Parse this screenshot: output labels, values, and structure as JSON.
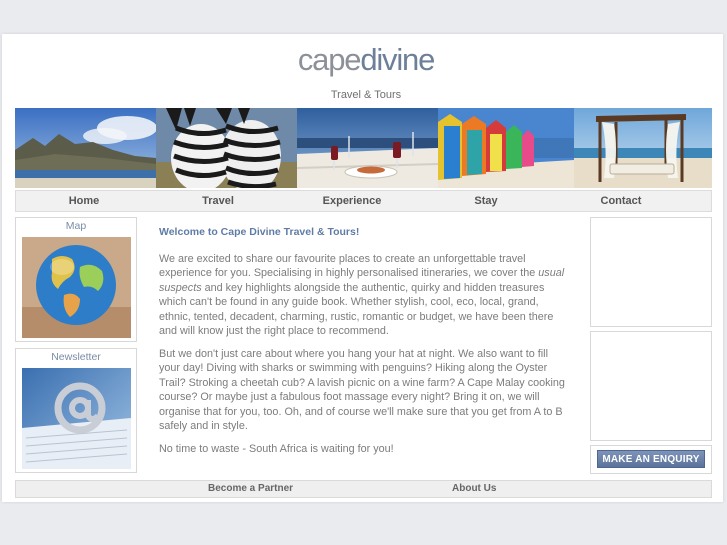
{
  "logo": {
    "word1": "cape",
    "word2": "divine",
    "tagline": "Travel & Tours"
  },
  "banner": {
    "images": [
      "mountain-beach-photo",
      "zebras-photo",
      "wine-table-photo",
      "beach-huts-photo",
      "beach-cabana-photo"
    ]
  },
  "nav": {
    "items": [
      "Home",
      "Travel",
      "Experience",
      "Stay",
      "Contact"
    ]
  },
  "sidebar": {
    "map_label": "Map",
    "newsletter_label": "Newsletter"
  },
  "main": {
    "heading": "Welcome to Cape Divine Travel & Tours!",
    "p1_a": "We are excited to share our favourite places to create an unforgettable travel experience for you. Specialising in highly personalised itineraries, we cover the ",
    "p1_em": "usual suspects",
    "p1_b": " and key highlights alongside the authentic, quirky and hidden treasures which can't be found in any guide book. Whether stylish, cool, eco, local, grand, ethnic, tented, decadent, charming, rustic, romantic or budget, we have been there and will know just the right place to recommend.",
    "p2": "But we don't just care about where you hang your hat at night. We also want to fill your day! Diving with sharks or swimming with penguins? Hiking along the Oyster Trail? Stroking a cheetah cub? A lavish picnic on a wine farm? A Cape Malay cooking course? Or maybe just a fabulous foot massage every night? Bring it on, we will organise that for you, too. Oh, and of course we'll make sure that you get from A to B safely and in style.",
    "p3": "No time to waste - South Africa is waiting for you!"
  },
  "right": {
    "enquiry_label": "MAKE AN ENQUIRY"
  },
  "footer": {
    "partner_label": "Become a Partner",
    "about_label": "About Us"
  },
  "colors": {
    "accent": "#5f7ca6",
    "logo_gray": "#8c9099",
    "logo_blue": "#6d7f99",
    "nav_bg": "#f1f1f1"
  }
}
